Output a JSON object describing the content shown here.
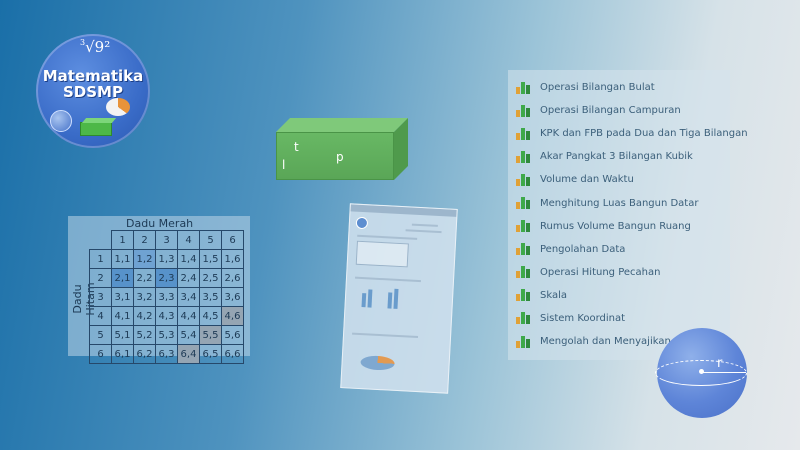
{
  "logo": {
    "formula_index": "3",
    "formula_body": "√9²",
    "title_line1": "Matematika",
    "title_line2": "SDSMP"
  },
  "cuboid": {
    "label_t": "t",
    "label_p": "p",
    "label_l": "l"
  },
  "dice_table": {
    "title": "Dadu Merah",
    "side_label": "Dadu Hitam",
    "columns": [
      "1",
      "2",
      "3",
      "4",
      "5",
      "6"
    ],
    "rows": [
      {
        "head": "1",
        "cells": [
          "1,1",
          "1,2",
          "1,3",
          "1,4",
          "1,5",
          "1,6"
        ]
      },
      {
        "head": "2",
        "cells": [
          "2,1",
          "2,2",
          "2,3",
          "2,4",
          "2,5",
          "2,6"
        ]
      },
      {
        "head": "3",
        "cells": [
          "3,1",
          "3,2",
          "3,3",
          "3,4",
          "3,5",
          "3,6"
        ]
      },
      {
        "head": "4",
        "cells": [
          "4,1",
          "4,2",
          "4,3",
          "4,4",
          "4,5",
          "4,6"
        ]
      },
      {
        "head": "5",
        "cells": [
          "5,1",
          "5,2",
          "5,3",
          "5,4",
          "5,5",
          "5,6"
        ]
      },
      {
        "head": "6",
        "cells": [
          "6,1",
          "6,2",
          "6,3",
          "6,4",
          "6,5",
          "6,6"
        ]
      }
    ]
  },
  "topics": [
    "Operasi Bilangan Bulat",
    "Operasi Bilangan Campuran",
    "KPK dan FPB pada Dua dan Tiga Bilangan",
    "Akar Pangkat 3 Bilangan Kubik",
    "Volume dan Waktu",
    "Menghitung Luas Bangun Datar",
    "Rumus Volume Bangun Ruang",
    "Pengolahan Data",
    "Operasi Hitung Pecahan",
    "Skala",
    "Sistem Koordinat",
    "Mengolah dan Menyajikan Data"
  ],
  "sphere": {
    "label_r": "r"
  },
  "colors": {
    "bg_start": "#1a6fa8",
    "bg_end": "#e6e9ec",
    "cuboid_green": "#68b864",
    "sphere_blue": "#5e85d8",
    "icon_orange": "#e0a136",
    "icon_green": "#3ea94a"
  }
}
